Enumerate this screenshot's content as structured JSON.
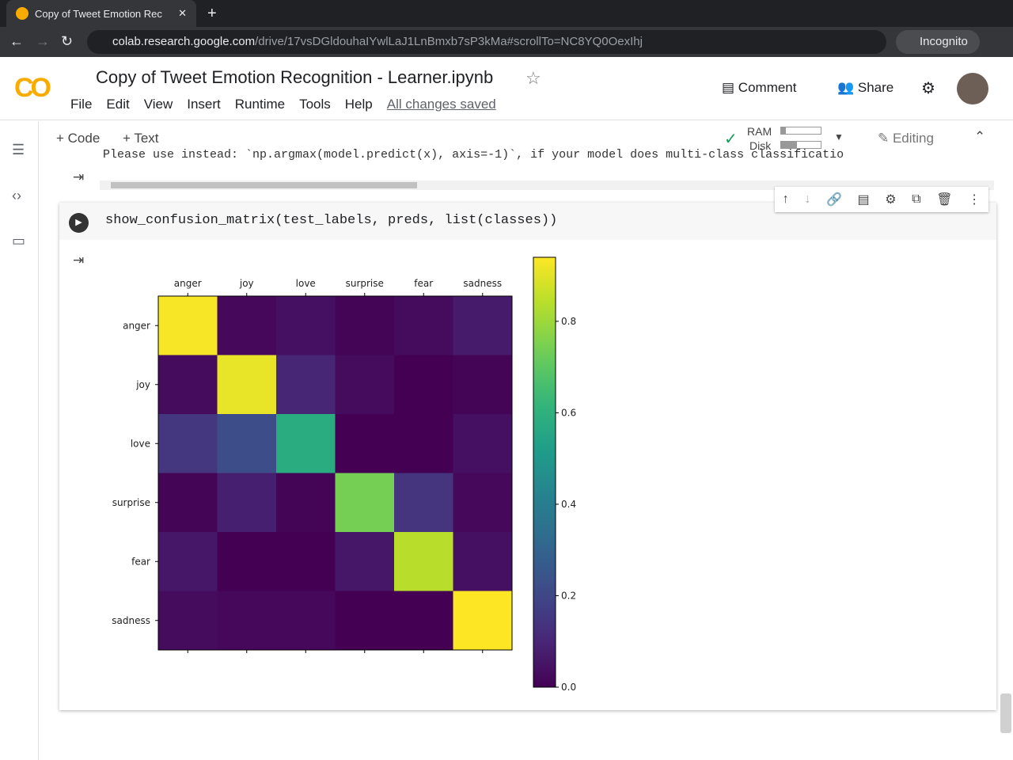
{
  "browser": {
    "tab_title": "Copy of Tweet Emotion Rec",
    "url_host": "colab.research.google.com",
    "url_path": "/drive/17vsDGldouhaIYwlLaJ1LnBmxb7sP3kMa#scrollTo=NC8YQ0OexIhj",
    "incognito": "Incognito"
  },
  "header": {
    "title": "Copy of Tweet Emotion Recognition - Learner.ipynb",
    "menu": [
      "File",
      "Edit",
      "View",
      "Insert",
      "Runtime",
      "Tools",
      "Help"
    ],
    "saved": "All changes saved",
    "comment": "Comment",
    "share": "Share"
  },
  "toolbar": {
    "code": "+ Code",
    "text": "+ Text",
    "ram": "RAM",
    "disk": "Disk",
    "editing": "Editing"
  },
  "prev_output": "Please use instead: `np.argmax(model.predict(x), axis=-1)`, if your model does multi-class classificatio",
  "cell": {
    "code": "show_confusion_matrix(test_labels, preds, list(classes))"
  },
  "chart_data": {
    "type": "heatmap",
    "title": "",
    "xlabel": "",
    "ylabel": "",
    "categories": [
      "anger",
      "joy",
      "love",
      "surprise",
      "fear",
      "sadness"
    ],
    "values": [
      [
        0.93,
        0.02,
        0.04,
        0.01,
        0.03,
        0.07
      ],
      [
        0.03,
        0.91,
        0.1,
        0.03,
        0.0,
        0.01
      ],
      [
        0.15,
        0.22,
        0.58,
        0.0,
        0.0,
        0.04
      ],
      [
        0.01,
        0.08,
        0.01,
        0.74,
        0.14,
        0.02
      ],
      [
        0.06,
        0.0,
        0.0,
        0.06,
        0.84,
        0.04
      ],
      [
        0.03,
        0.02,
        0.02,
        0.0,
        0.0,
        0.94
      ]
    ],
    "colormap": "viridis",
    "colorbar_range": [
      0,
      0.94
    ],
    "colorbar_ticks": [
      "0.0",
      "0.2",
      "0.4",
      "0.6",
      "0.8"
    ]
  }
}
